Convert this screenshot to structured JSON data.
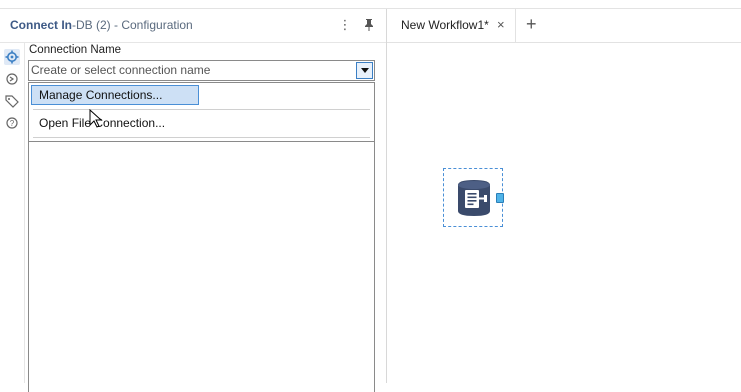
{
  "panel": {
    "title_bold": "Connect In",
    "title_rest": "-DB (2) - Configuration",
    "menu_icon": "vertical-dots-icon",
    "pin_icon": "pin-icon"
  },
  "rail": {
    "icons": [
      "gear-icon",
      "arrow-cycle-icon",
      "tag-icon",
      "help-icon"
    ]
  },
  "connection": {
    "label": "Connection Name",
    "placeholder": "Create or select connection name"
  },
  "dropdown": {
    "items": [
      "Manage Connections...",
      "Open File Connection..."
    ]
  },
  "tabs": {
    "workflow_tab": "New Workflow1*",
    "close_glyph": "×",
    "add_glyph": "+"
  },
  "colors": {
    "accent": "#3b7fc4",
    "tool_body": "#3a4a6b",
    "anchor": "#4fb3e8"
  }
}
